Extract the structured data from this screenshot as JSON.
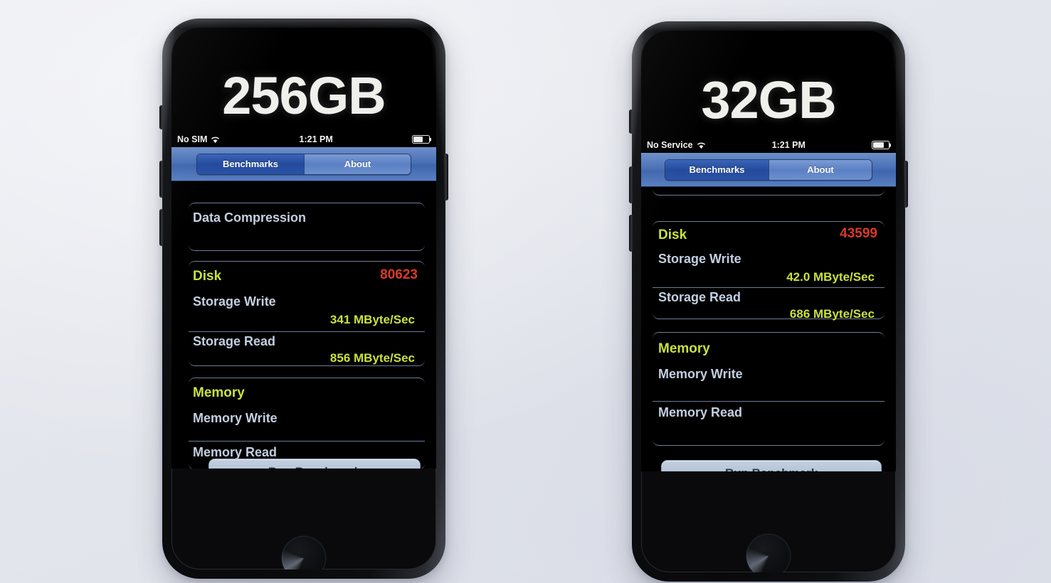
{
  "scene": {
    "description": "Two iPhones side by side running a storage benchmark app",
    "background_color": "#e6e8ee"
  },
  "phones": [
    {
      "id": "left-phone",
      "capacity_label": "256GB",
      "status_bar": {
        "carrier": "No SIM",
        "wifi_icon": "wifi-icon",
        "time": "1:21 PM",
        "battery_icon": "battery-icon",
        "battery_level_pct": 62
      },
      "segmented_control": {
        "selected": "Benchmarks",
        "tabs": [
          {
            "label": "Benchmarks",
            "selected": true
          },
          {
            "label": "About",
            "selected": false
          }
        ]
      },
      "sections": [
        {
          "name": "Data Compression",
          "is_section_header": false,
          "rows": [
            {
              "label": "Data Compression",
              "value": ""
            }
          ]
        },
        {
          "name": "Disk",
          "score": "80623",
          "rows": [
            {
              "label": "Storage Write",
              "value": "341 MByte/Sec"
            },
            {
              "label": "Storage Read",
              "value": "856 MByte/Sec"
            }
          ]
        },
        {
          "name": "Memory",
          "score": "",
          "rows": [
            {
              "label": "Memory Write",
              "value": ""
            },
            {
              "label": "Memory Read",
              "value": ""
            }
          ]
        }
      ],
      "run_button_label": "Run Benchmark"
    },
    {
      "id": "right-phone",
      "capacity_label": "32GB",
      "status_bar": {
        "carrier": "No Service",
        "wifi_icon": "wifi-icon",
        "time": "1:21 PM",
        "battery_icon": "battery-icon",
        "battery_level_pct": 72
      },
      "segmented_control": {
        "selected": "Benchmarks",
        "tabs": [
          {
            "label": "Benchmarks",
            "selected": true
          },
          {
            "label": "About",
            "selected": false
          }
        ]
      },
      "sections": [
        {
          "name": "Disk",
          "score": "43599",
          "rows": [
            {
              "label": "Storage Write",
              "value": "42.0 MByte/Sec"
            },
            {
              "label": "Storage Read",
              "value": "686 MByte/Sec"
            }
          ]
        },
        {
          "name": "Memory",
          "score": "",
          "rows": [
            {
              "label": "Memory Write",
              "value": ""
            },
            {
              "label": "Memory Read",
              "value": ""
            }
          ]
        }
      ],
      "run_button_label": "Run Benchmark"
    }
  ],
  "colors": {
    "section_header": "#c9e13c",
    "score_red": "#d93a2b",
    "row_label": "#c3cfe0",
    "value_green": "#c9e13c",
    "seg_bar_blue": "#4a71b6",
    "seg_selected_blue": "#244a9c",
    "run_button": "#b4c2d6"
  }
}
